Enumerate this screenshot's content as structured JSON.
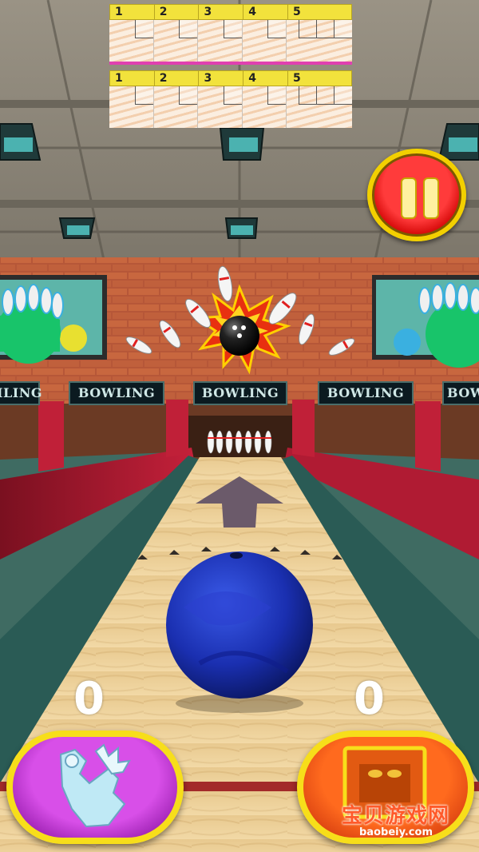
{
  "scoreboards": [
    {
      "frames": [
        "1",
        "2",
        "3",
        "4",
        "5"
      ],
      "totals": [
        "",
        "",
        "",
        "",
        ""
      ]
    },
    {
      "frames": [
        "1",
        "2",
        "3",
        "4",
        "5"
      ],
      "totals": [
        "",
        "",
        "",
        "",
        ""
      ]
    }
  ],
  "signs": {
    "sign1": "ILING",
    "sign2": "BOWLING",
    "sign3": "BOWLING",
    "sign4": "BOWLING",
    "sign5": "BOW"
  },
  "scores": {
    "left": "0",
    "right": "0"
  },
  "watermark": {
    "brand": "宝贝游戏网",
    "url": "baobeiy.com"
  },
  "colors": {
    "pause": "#e01010",
    "spin_button": "#b42ad0",
    "throw_button": "#ef5a18",
    "border_gold": "#f7de1a",
    "ball": "#1a2fb0"
  }
}
